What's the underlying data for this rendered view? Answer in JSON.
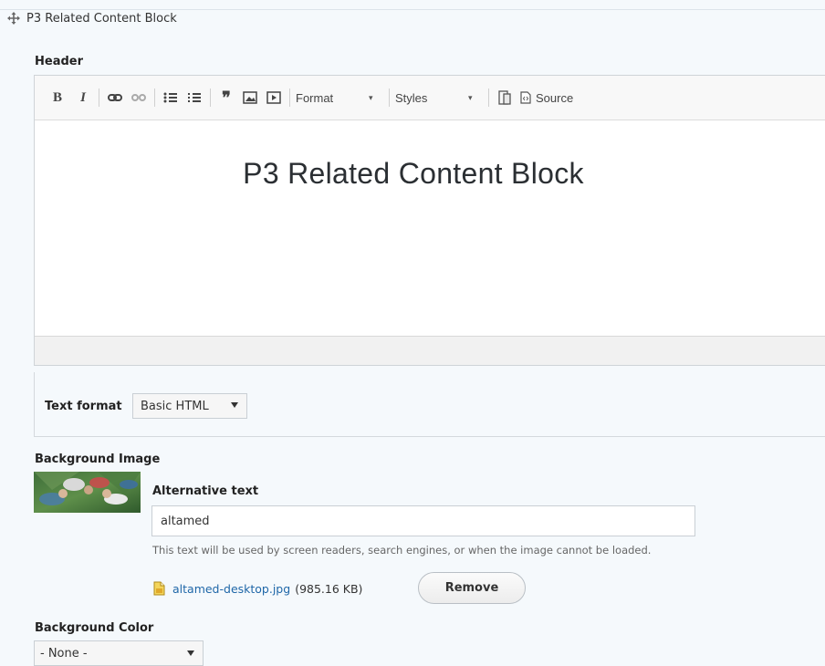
{
  "block": {
    "title": "P3 Related Content Block"
  },
  "header_field": {
    "label": "Header"
  },
  "toolbar": {
    "bold_label": "B",
    "italic_label": "I",
    "format_label": "Format",
    "styles_label": "Styles",
    "source_label": "Source",
    "icons": [
      "bold-icon",
      "italic-icon",
      "link-icon",
      "unlink-icon",
      "bulleted-list-icon",
      "numbered-list-icon",
      "blockquote-icon",
      "image-icon",
      "media-icon",
      "format-dropdown",
      "styles-dropdown",
      "template-icon",
      "source-icon"
    ]
  },
  "editor": {
    "content_heading": "P3 Related Content Block"
  },
  "text_format": {
    "label": "Text format",
    "selected": "Basic HTML"
  },
  "background_image": {
    "label": "Background Image",
    "alt_label": "Alternative text",
    "alt_value": "altamed",
    "help": "This text will be used by screen readers, search engines, or when the image cannot be loaded.",
    "file_name": "altamed-desktop.jpg",
    "file_size": "(985.16 KB)",
    "remove_label": "Remove"
  },
  "background_color": {
    "label": "Background Color",
    "selected": "- None -"
  },
  "colors": {
    "link": "#1f67a8",
    "page_bg": "#f5f9fc",
    "heading": "#2b2f33"
  }
}
